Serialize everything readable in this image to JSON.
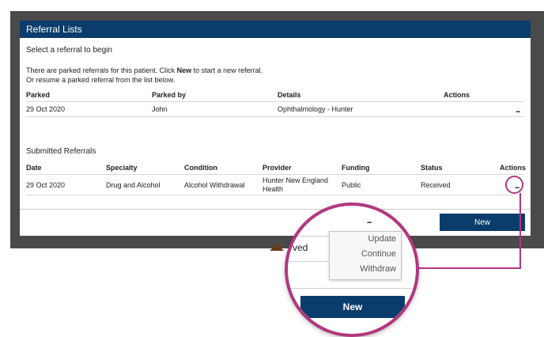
{
  "panel": {
    "title": "Referral Lists",
    "instruction": "Select a referral to begin",
    "info_line1_pre": "There are parked referrals for this patient. Click ",
    "info_line1_bold": "New",
    "info_line1_post": " to start a new referral.",
    "info_line2": "Or resume a parked referral from the list below."
  },
  "parked": {
    "columns": [
      "Parked",
      "Parked by",
      "Details",
      "Actions"
    ],
    "rows": [
      {
        "parked": "29 Oct 2020",
        "parked_by": "John",
        "details": "Ophthalmology - Hunter",
        "actions": "..."
      }
    ]
  },
  "submitted": {
    "heading": "Submitted Referrals",
    "columns": [
      "Date",
      "Specialty",
      "Condition",
      "Provider",
      "Funding",
      "Status",
      "Actions"
    ],
    "rows": [
      {
        "date": "29 Oct 2020",
        "specialty": "Drug and Alcohol",
        "condition": "Alcohol Withdrawal",
        "provider_line1": "Hunter New England",
        "provider_line2": "Health",
        "funding": "Public",
        "status": "Received",
        "actions": "..."
      }
    ]
  },
  "new_button_label": "New",
  "magnifier": {
    "dots": "...",
    "received_fragment": "ved",
    "menu": [
      "Update",
      "Continue",
      "Withdraw"
    ],
    "new_button_label": "New"
  },
  "colors": {
    "header_bg": "#0a3d6b",
    "highlight": "#b0387e",
    "backdrop": "#4a4a4a"
  }
}
